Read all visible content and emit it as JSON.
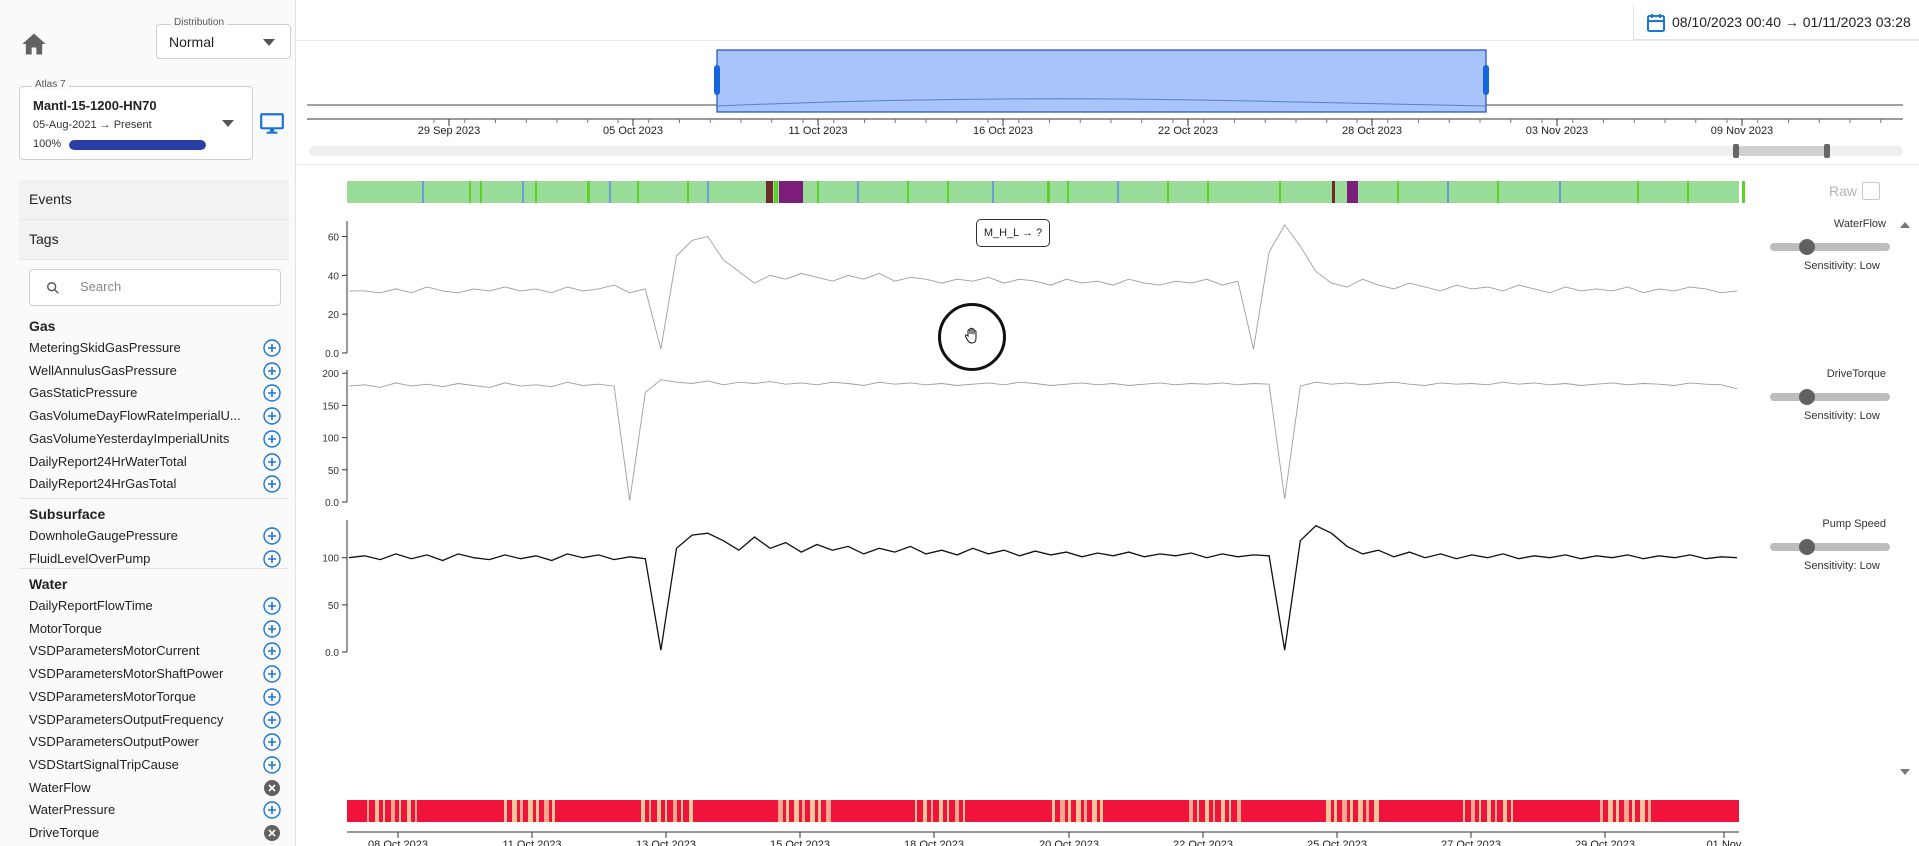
{
  "sidebar": {
    "distribution": {
      "label": "Distribution",
      "value": "Normal"
    },
    "asset": {
      "legend": "Atlas 7",
      "name": "Mantl-15-1200-HN70",
      "range": "05-Aug-2021 → Present",
      "progress_label": "100%",
      "progress": 1.0
    },
    "events_label": "Events",
    "tags_label": "Tags",
    "search_placeholder": "Search",
    "groups": [
      {
        "title": "Gas",
        "tags": [
          {
            "label": "MeteringSkidGasPressure",
            "state": "add"
          },
          {
            "label": "WellAnnulusGasPressure",
            "state": "add"
          },
          {
            "label": "GasStaticPressure",
            "state": "add"
          },
          {
            "label": "GasVolumeDayFlowRateImperialU...",
            "state": "add"
          },
          {
            "label": "GasVolumeYesterdayImperialUnits",
            "state": "add"
          },
          {
            "label": "DailyReport24HrWaterTotal",
            "state": "add"
          },
          {
            "label": "DailyReport24HrGasTotal",
            "state": "add"
          }
        ]
      },
      {
        "title": "Subsurface",
        "tags": [
          {
            "label": "DownholeGaugePressure",
            "state": "add"
          },
          {
            "label": "FluidLevelOverPump",
            "state": "add"
          }
        ]
      },
      {
        "title": "Water",
        "tags": [
          {
            "label": "DailyReportFlowTime",
            "state": "add"
          },
          {
            "label": "MotorTorque",
            "state": "add"
          },
          {
            "label": "VSDParametersMotorCurrent",
            "state": "add"
          },
          {
            "label": "VSDParametersMotorShaftPower",
            "state": "add"
          },
          {
            "label": "VSDParametersMotorTorque",
            "state": "add"
          },
          {
            "label": "VSDParametersOutputFrequency",
            "state": "add"
          },
          {
            "label": "VSDParametersOutputPower",
            "state": "add"
          },
          {
            "label": "VSDStartSignalTripCause",
            "state": "add"
          },
          {
            "label": "WaterFlow",
            "state": "remove"
          },
          {
            "label": "WaterPressure",
            "state": "add"
          },
          {
            "label": "DriveTorque",
            "state": "remove"
          }
        ]
      }
    ]
  },
  "header": {
    "date_range": "08/10/2023 00:40 → 01/11/2023 03:28"
  },
  "overview": {
    "ticks": [
      "29 Sep 2023",
      "05 Oct 2023",
      "11 Oct 2023",
      "16 Oct 2023",
      "22 Oct 2023",
      "28 Oct 2023",
      "03 Nov 2023",
      "09 Nov 2023"
    ],
    "selection": {
      "start": "08/10/2023 00:40",
      "end": "01/11/2023 03:28"
    }
  },
  "raw_label": "Raw",
  "annotation_label": "M_H_L → ?",
  "colors": {
    "accent": "#1976d2",
    "state_green": "#98dc98",
    "state_purple": "#7b1f7b",
    "state_red": "#f0143c",
    "selection": "#a9c4fb"
  },
  "chart_data": [
    {
      "type": "line",
      "title": "",
      "series": [
        {
          "name": "WaterFlow",
          "values": [
            32,
            32,
            31,
            33,
            31,
            34,
            32,
            31,
            33,
            32,
            34,
            32,
            33,
            31,
            34,
            32,
            33,
            35,
            31,
            33,
            2,
            50,
            58,
            60,
            48,
            42,
            36,
            40,
            38,
            41,
            39,
            37,
            40,
            38,
            41,
            37,
            39,
            38,
            36,
            38,
            37,
            39,
            36,
            38,
            37,
            35,
            38,
            36,
            37,
            35,
            38,
            36,
            35,
            37,
            36,
            38,
            35,
            37,
            2,
            52,
            66,
            55,
            42,
            36,
            34,
            38,
            35,
            33,
            36,
            34,
            32,
            35,
            33,
            34,
            32,
            35,
            33,
            31,
            34,
            32,
            33,
            32,
            34,
            31,
            33,
            32,
            34,
            33,
            31,
            32
          ]
        }
      ],
      "y_ticks": [
        "0.0",
        "20",
        "40",
        "60"
      ],
      "ylim": [
        0,
        68
      ],
      "sensitivity": "Sensitivity: Low"
    },
    {
      "type": "line",
      "title": "",
      "series": [
        {
          "name": "DriveTorque",
          "values": [
            180,
            182,
            178,
            185,
            180,
            183,
            179,
            184,
            181,
            178,
            185,
            180,
            182,
            179,
            186,
            181,
            183,
            180,
            2,
            170,
            190,
            186,
            184,
            188,
            182,
            186,
            184,
            187,
            183,
            185,
            182,
            186,
            184,
            181,
            186,
            183,
            185,
            182,
            184,
            181,
            183,
            185,
            182,
            186,
            184,
            181,
            183,
            185,
            182,
            184,
            181,
            183,
            185,
            182,
            184,
            183,
            185,
            182,
            184,
            183,
            5,
            180,
            186,
            183,
            185,
            182,
            184,
            186,
            183,
            181,
            185,
            183,
            184,
            182,
            186,
            183,
            185,
            182,
            184,
            181,
            183,
            185,
            182,
            184,
            183,
            181,
            185,
            183,
            182,
            176
          ]
        }
      ],
      "y_ticks": [
        "0.0",
        "50",
        "100",
        "150",
        "200"
      ],
      "ylim": [
        0,
        205
      ],
      "sensitivity": "Sensitivity: Low"
    },
    {
      "type": "line",
      "title": "",
      "series": [
        {
          "name": "Pump Speed",
          "values": [
            100,
            102,
            98,
            104,
            99,
            103,
            97,
            104,
            100,
            98,
            103,
            99,
            102,
            97,
            104,
            100,
            103,
            98,
            101,
            99,
            2,
            110,
            124,
            126,
            118,
            108,
            122,
            110,
            116,
            106,
            114,
            108,
            112,
            104,
            110,
            106,
            112,
            104,
            108,
            103,
            110,
            104,
            108,
            102,
            107,
            103,
            106,
            101,
            105,
            102,
            106,
            101,
            104,
            102,
            105,
            100,
            104,
            101,
            103,
            102,
            2,
            118,
            134,
            126,
            112,
            104,
            108,
            101,
            106,
            100,
            104,
            99,
            103,
            100,
            104,
            99,
            102,
            100,
            103,
            99,
            102,
            100,
            103,
            99,
            102,
            100,
            103,
            99,
            101,
            100
          ]
        }
      ],
      "y_ticks": [
        "0.0",
        "50",
        "100"
      ],
      "ylim": [
        0,
        140
      ],
      "sensitivity": "Sensitivity: Low"
    }
  ],
  "bottom_axis": {
    "ticks": [
      "08 Oct 2023",
      "11 Oct 2023",
      "13 Oct 2023",
      "15 Oct 2023",
      "18 Oct 2023",
      "20 Oct 2023",
      "22 Oct 2023",
      "25 Oct 2023",
      "27 Oct 2023",
      "29 Oct 2023",
      "01 Nov"
    ]
  }
}
